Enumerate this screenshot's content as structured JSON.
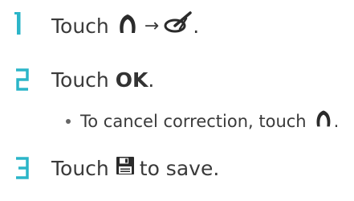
{
  "steps": [
    {
      "number": "1",
      "prefix": "Touch",
      "arrow": "→",
      "period": ".",
      "icons": [
        "contour-icon",
        "correction-pencil-icon"
      ]
    },
    {
      "number": "2",
      "prefix": "Touch",
      "bold": "OK",
      "period": "."
    },
    {
      "number": "3",
      "prefix": "Touch",
      "suffix": "to save.",
      "icons": [
        "save-icon"
      ]
    }
  ],
  "note": {
    "text": "To cancel correction, touch",
    "period": ".",
    "icons": [
      "contour-icon"
    ]
  },
  "colors": {
    "accent": "#2bb5c8",
    "text": "#3a3a3a"
  }
}
